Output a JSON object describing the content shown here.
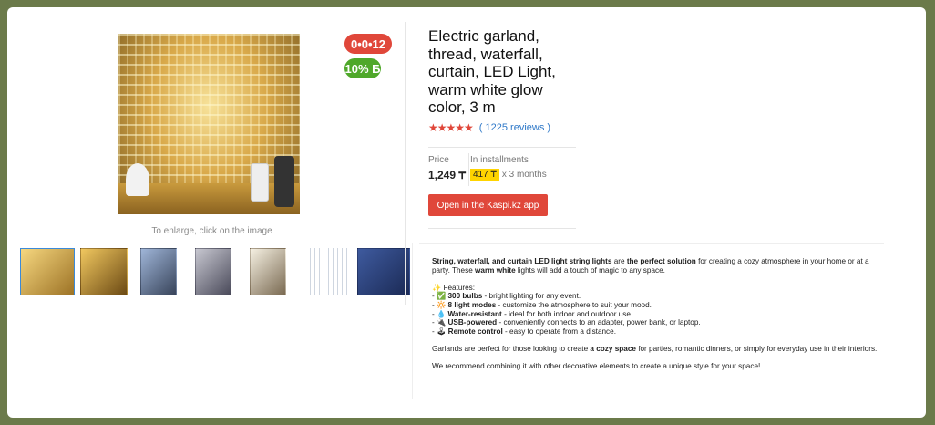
{
  "gallery": {
    "badge_time": "0•0•12",
    "badge_percent": "10% Б",
    "enlarge_hint": "To enlarge, click on the image",
    "thumbnails_count": 7
  },
  "product": {
    "title": "Electric garland, thread, waterfall, curtain, LED Light, warm white glow color, 3 m",
    "stars": "★★★★★",
    "reviews": "( 1225 reviews )",
    "price_label": "Price",
    "price": "1,249 ₸",
    "installments_label": "In installments",
    "installment_amount": "417 ₸",
    "installment_term": "x 3 months",
    "open_button": "Open in the Kaspi.kz app"
  },
  "description": {
    "intro_bold1": "String, waterfall, and curtain LED light string lights",
    "intro_text1": " are ",
    "intro_bold2": "the perfect solution",
    "intro_text2": " for creating a cozy atmosphere in your home or at a party. These ",
    "intro_bold3": "warm white",
    "intro_text3": " lights will add a touch of magic to any space.",
    "features_heading": "✨ Features:",
    "features": [
      {
        "prefix": "- ✅ ",
        "bold": "300 bulbs",
        "text": " - bright lighting for any event."
      },
      {
        "prefix": "- 🔆 ",
        "bold": "8 light modes",
        "text": " - customize the atmosphere to suit your mood."
      },
      {
        "prefix": "- 💧 ",
        "bold": "Water-resistant",
        "text": " - ideal for both indoor and outdoor use."
      },
      {
        "prefix": "- 🔌 ",
        "bold": "USB-powered",
        "text": " - conveniently connects to an adapter, power bank, or laptop."
      },
      {
        "prefix": "- 🕹 ",
        "bold": "Remote control",
        "text": " - easy to operate from a distance."
      }
    ],
    "para2_text1": "Garlands are perfect for those looking to create ",
    "para2_bold": "a cozy space",
    "para2_text2": " for parties, romantic dinners, or simply for everyday use in their interiors.",
    "para3": "We recommend combining it with other decorative elements to create a unique style for your space!"
  },
  "colors": {
    "accent_red": "#e0473a",
    "accent_green": "#4fa82a",
    "link_blue": "#2e78c8",
    "installment_yellow": "#ffd400",
    "frame_bg": "#6b7a4a"
  }
}
